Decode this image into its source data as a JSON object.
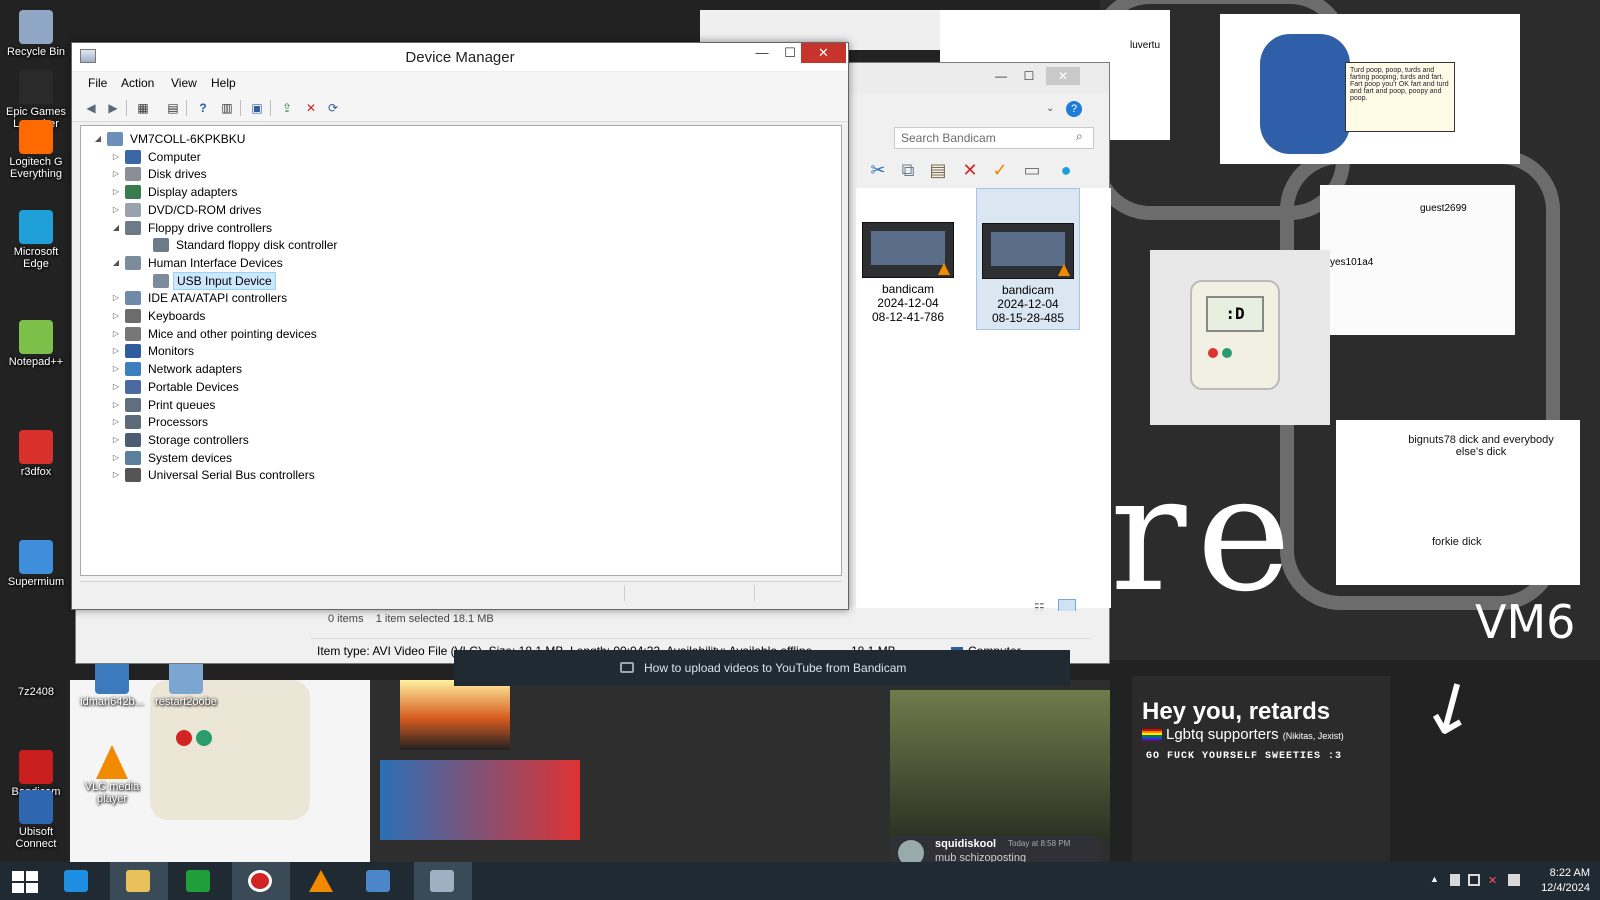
{
  "desktop": {
    "icons": [
      {
        "label": "Recycle Bin",
        "color": "#8fa7c4"
      },
      {
        "label": "Epic Games Launcher",
        "color": "#2a2a2a"
      },
      {
        "label": "Logitech G Everything",
        "color": "#ff6a00"
      },
      {
        "label": "Microsoft Edge",
        "color": "#1fa0d8"
      },
      {
        "label": "Notepad++",
        "color": "#7cc04a"
      },
      {
        "label": "r3dfox",
        "color": "#d8302a"
      },
      {
        "label": "Supermium",
        "color": "#3e8edb"
      },
      {
        "label": "7z2408",
        "color": "#222222"
      },
      {
        "label": "Bandicam",
        "color": "#c81e1e"
      },
      {
        "label": "Ubisoft Connect",
        "color": "#2e67b0"
      },
      {
        "label": "idman642b...",
        "color": "#3b7bbd"
      },
      {
        "label": "restart2oobe",
        "color": "#7aa6d1"
      },
      {
        "label": "VLC media player",
        "color": "#f28a00"
      }
    ],
    "wallpaper": {
      "cat_note": "Turd poop, poop, turds and farting pooping, turds and fart. Fart poop you'r OK fart and turd and fart and poop, poopy and poop.",
      "plush_screen": ":D",
      "note_1": "bignuts78 dick and everybody else's dick",
      "note_2": "forkie dick",
      "sketch_1": "guest2699",
      "sketch_2": "yes101a4",
      "big_text": "re",
      "vm6": "VM6",
      "meme_line_1": "Hey you, retards",
      "meme_line_2": "Lgbtq supporters",
      "meme_line_2_extra": "(Nikitas, Jexist)",
      "meme_line_3": "GO FUCK YOURSELF SWEETIES :3",
      "discord_user": "squidiskool",
      "discord_time": "Today at 8:58 PM",
      "discord_message": "mub schizoposting",
      "face_label": "luvertu"
    }
  },
  "explorer": {
    "search_placeholder": "Search Bandicam",
    "files": [
      {
        "name": "bandicam",
        "date": "2024-12-04",
        "time": "08-12-41-786",
        "selected": false
      },
      {
        "name": "bandicam",
        "date": "2024-12-04",
        "time": "08-15-28-485",
        "selected": true
      }
    ],
    "status_count": "0 items",
    "status_selected": "1 item selected  18.1 MB",
    "details": "Item type: AVI Video File (VLC), Size: 18.1 MB, Length: 00:04:32, Availability: Available offline",
    "details_size": "18.1 MB",
    "details_location": "Computer"
  },
  "bandicam_notice": {
    "text": "How to upload videos to YouTube from Bandicam"
  },
  "device_manager": {
    "title": "Device Manager",
    "menu": [
      "File",
      "Action",
      "View",
      "Help"
    ],
    "toolbar": [
      "back-icon",
      "forward-icon",
      "show-hide-console-tree-icon",
      "properties-icon",
      "help-icon",
      "action-pane-icon",
      "monitor-icon",
      "update-driver-icon",
      "uninstall-device-icon",
      "scan-hardware-icon"
    ],
    "tree": [
      {
        "label": "VM7COLL-6KPKBKU",
        "level": 0,
        "expanded": true,
        "icon": "computer-root-icon"
      },
      {
        "label": "Computer",
        "level": 1,
        "expanded": false,
        "icon": "computer-icon"
      },
      {
        "label": "Disk drives",
        "level": 1,
        "expanded": false,
        "icon": "disk-drive-icon"
      },
      {
        "label": "Display adapters",
        "level": 1,
        "expanded": false,
        "icon": "display-adapter-icon"
      },
      {
        "label": "DVD/CD-ROM drives",
        "level": 1,
        "expanded": false,
        "icon": "dvd-drive-icon"
      },
      {
        "label": "Floppy drive controllers",
        "level": 1,
        "expanded": true,
        "icon": "floppy-controller-icon"
      },
      {
        "label": "Standard floppy disk controller",
        "level": 2,
        "expanded": null,
        "icon": "floppy-controller-icon"
      },
      {
        "label": "Human Interface Devices",
        "level": 1,
        "expanded": true,
        "icon": "hid-icon"
      },
      {
        "label": "USB Input Device",
        "level": 2,
        "expanded": null,
        "icon": "hid-icon",
        "selected": true
      },
      {
        "label": "IDE ATA/ATAPI controllers",
        "level": 1,
        "expanded": false,
        "icon": "ide-controller-icon"
      },
      {
        "label": "Keyboards",
        "level": 1,
        "expanded": false,
        "icon": "keyboard-icon"
      },
      {
        "label": "Mice and other pointing devices",
        "level": 1,
        "expanded": false,
        "icon": "mouse-icon"
      },
      {
        "label": "Monitors",
        "level": 1,
        "expanded": false,
        "icon": "monitor-icon"
      },
      {
        "label": "Network adapters",
        "level": 1,
        "expanded": false,
        "icon": "network-adapter-icon"
      },
      {
        "label": "Portable Devices",
        "level": 1,
        "expanded": false,
        "icon": "portable-device-icon"
      },
      {
        "label": "Print queues",
        "level": 1,
        "expanded": false,
        "icon": "printer-icon"
      },
      {
        "label": "Processors",
        "level": 1,
        "expanded": false,
        "icon": "processor-icon"
      },
      {
        "label": "Storage controllers",
        "level": 1,
        "expanded": false,
        "icon": "storage-controller-icon"
      },
      {
        "label": "System devices",
        "level": 1,
        "expanded": false,
        "icon": "system-device-icon"
      },
      {
        "label": "Universal Serial Bus controllers",
        "level": 1,
        "expanded": false,
        "icon": "usb-icon"
      }
    ]
  },
  "taskbar": {
    "buttons": [
      {
        "name": "start",
        "icon": "windows-logo-icon",
        "color": "#ffffff",
        "active": false
      },
      {
        "name": "internet-explorer",
        "icon": "internet-explorer-icon",
        "color": "#1e8ee2",
        "active": false
      },
      {
        "name": "file-explorer",
        "icon": "folder-icon",
        "color": "#e8c15a",
        "active": true
      },
      {
        "name": "store",
        "icon": "store-icon",
        "color": "#1f9e3a",
        "active": false
      },
      {
        "name": "bandicam",
        "icon": "bandicam-icon",
        "color": "#d32424",
        "active": true
      },
      {
        "name": "vlc",
        "icon": "vlc-cone-icon",
        "color": "#f28a00",
        "active": false
      },
      {
        "name": "remote-desktop",
        "icon": "remote-desktop-icon",
        "color": "#4b86c8",
        "active": false
      },
      {
        "name": "device-manager",
        "icon": "device-manager-icon",
        "color": "#9fb0c2",
        "active": true
      }
    ],
    "clock_time": "8:22 AM",
    "clock_date": "12/4/2024"
  }
}
